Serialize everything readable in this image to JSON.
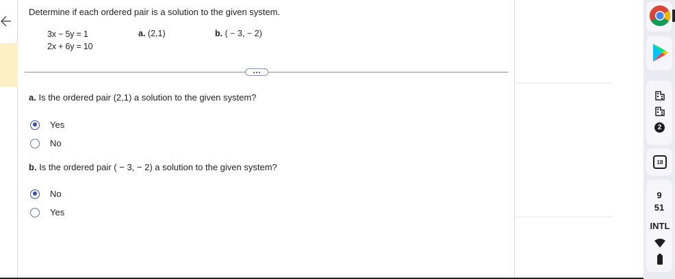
{
  "question": {
    "prompt": "Determine if each ordered pair is a solution to the given system.",
    "equation1": "3x − 5y = 1",
    "equation2": "2x + 6y = 10",
    "option_a_letter": "a.",
    "option_a_value": "(2,1)",
    "option_b_letter": "b.",
    "option_b_value": "( − 3, − 2)"
  },
  "part_a": {
    "letter": "a.",
    "text": "Is the ordered pair (2,1) a solution to the given system?",
    "options": [
      {
        "label": "Yes",
        "selected": true
      },
      {
        "label": "No",
        "selected": false
      }
    ]
  },
  "part_b": {
    "letter": "b.",
    "text": "Is the ordered pair ( − 3, − 2) a solution to the given system?",
    "options": [
      {
        "label": "No",
        "selected": true
      },
      {
        "label": "Yes",
        "selected": false
      }
    ]
  },
  "shelf": {
    "notification_count": "2",
    "calendar_day": "18",
    "time_hour": "9",
    "time_minute": "51",
    "input_method": "INTL"
  },
  "colors": {
    "radio_selected": "#3c4db3",
    "highlight_tab": "#fdf0c4"
  },
  "icons": [
    "back-arrow-icon",
    "chrome-icon",
    "play-store-icon",
    "building-icon",
    "calendar-icon",
    "wifi-icon",
    "battery-icon"
  ]
}
